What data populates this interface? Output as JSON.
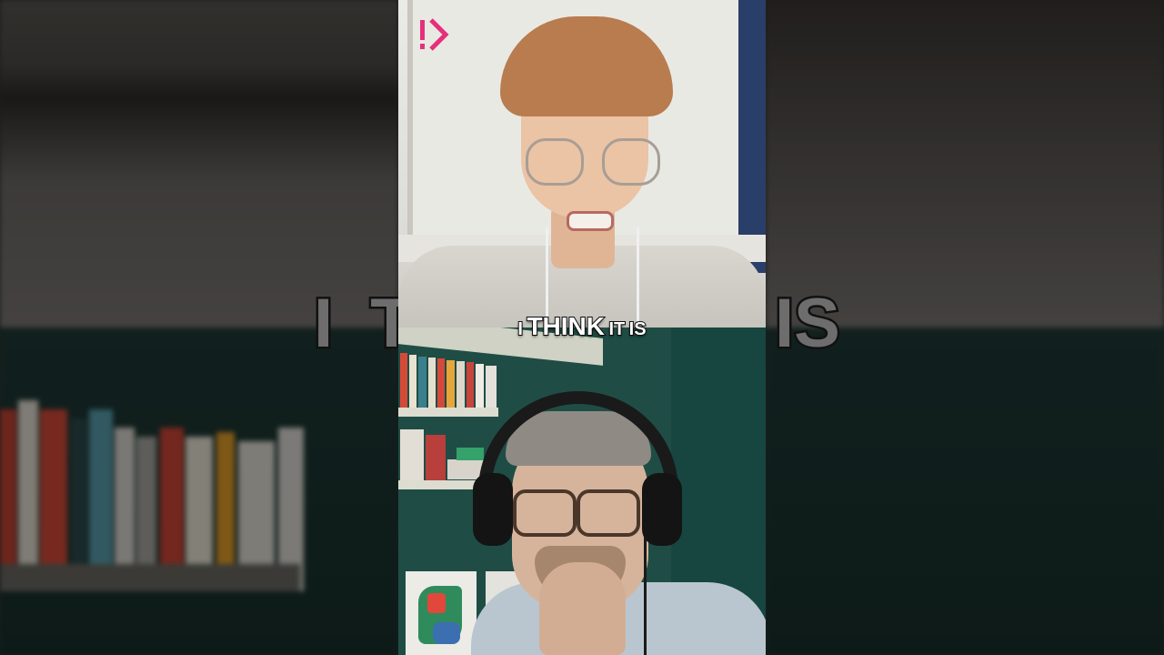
{
  "subtitle": {
    "word1": "I",
    "word2": "THINK",
    "word3": "IT",
    "word4": "IS"
  },
  "background_text": {
    "left": "I T",
    "right": "IS"
  },
  "colors": {
    "logo": "#e5307a",
    "wall_green": "#1f4d45",
    "subtitle_fill": "#ffffff",
    "subtitle_stroke": "#111111"
  },
  "icons": {
    "logo": "brand-play-icon"
  }
}
